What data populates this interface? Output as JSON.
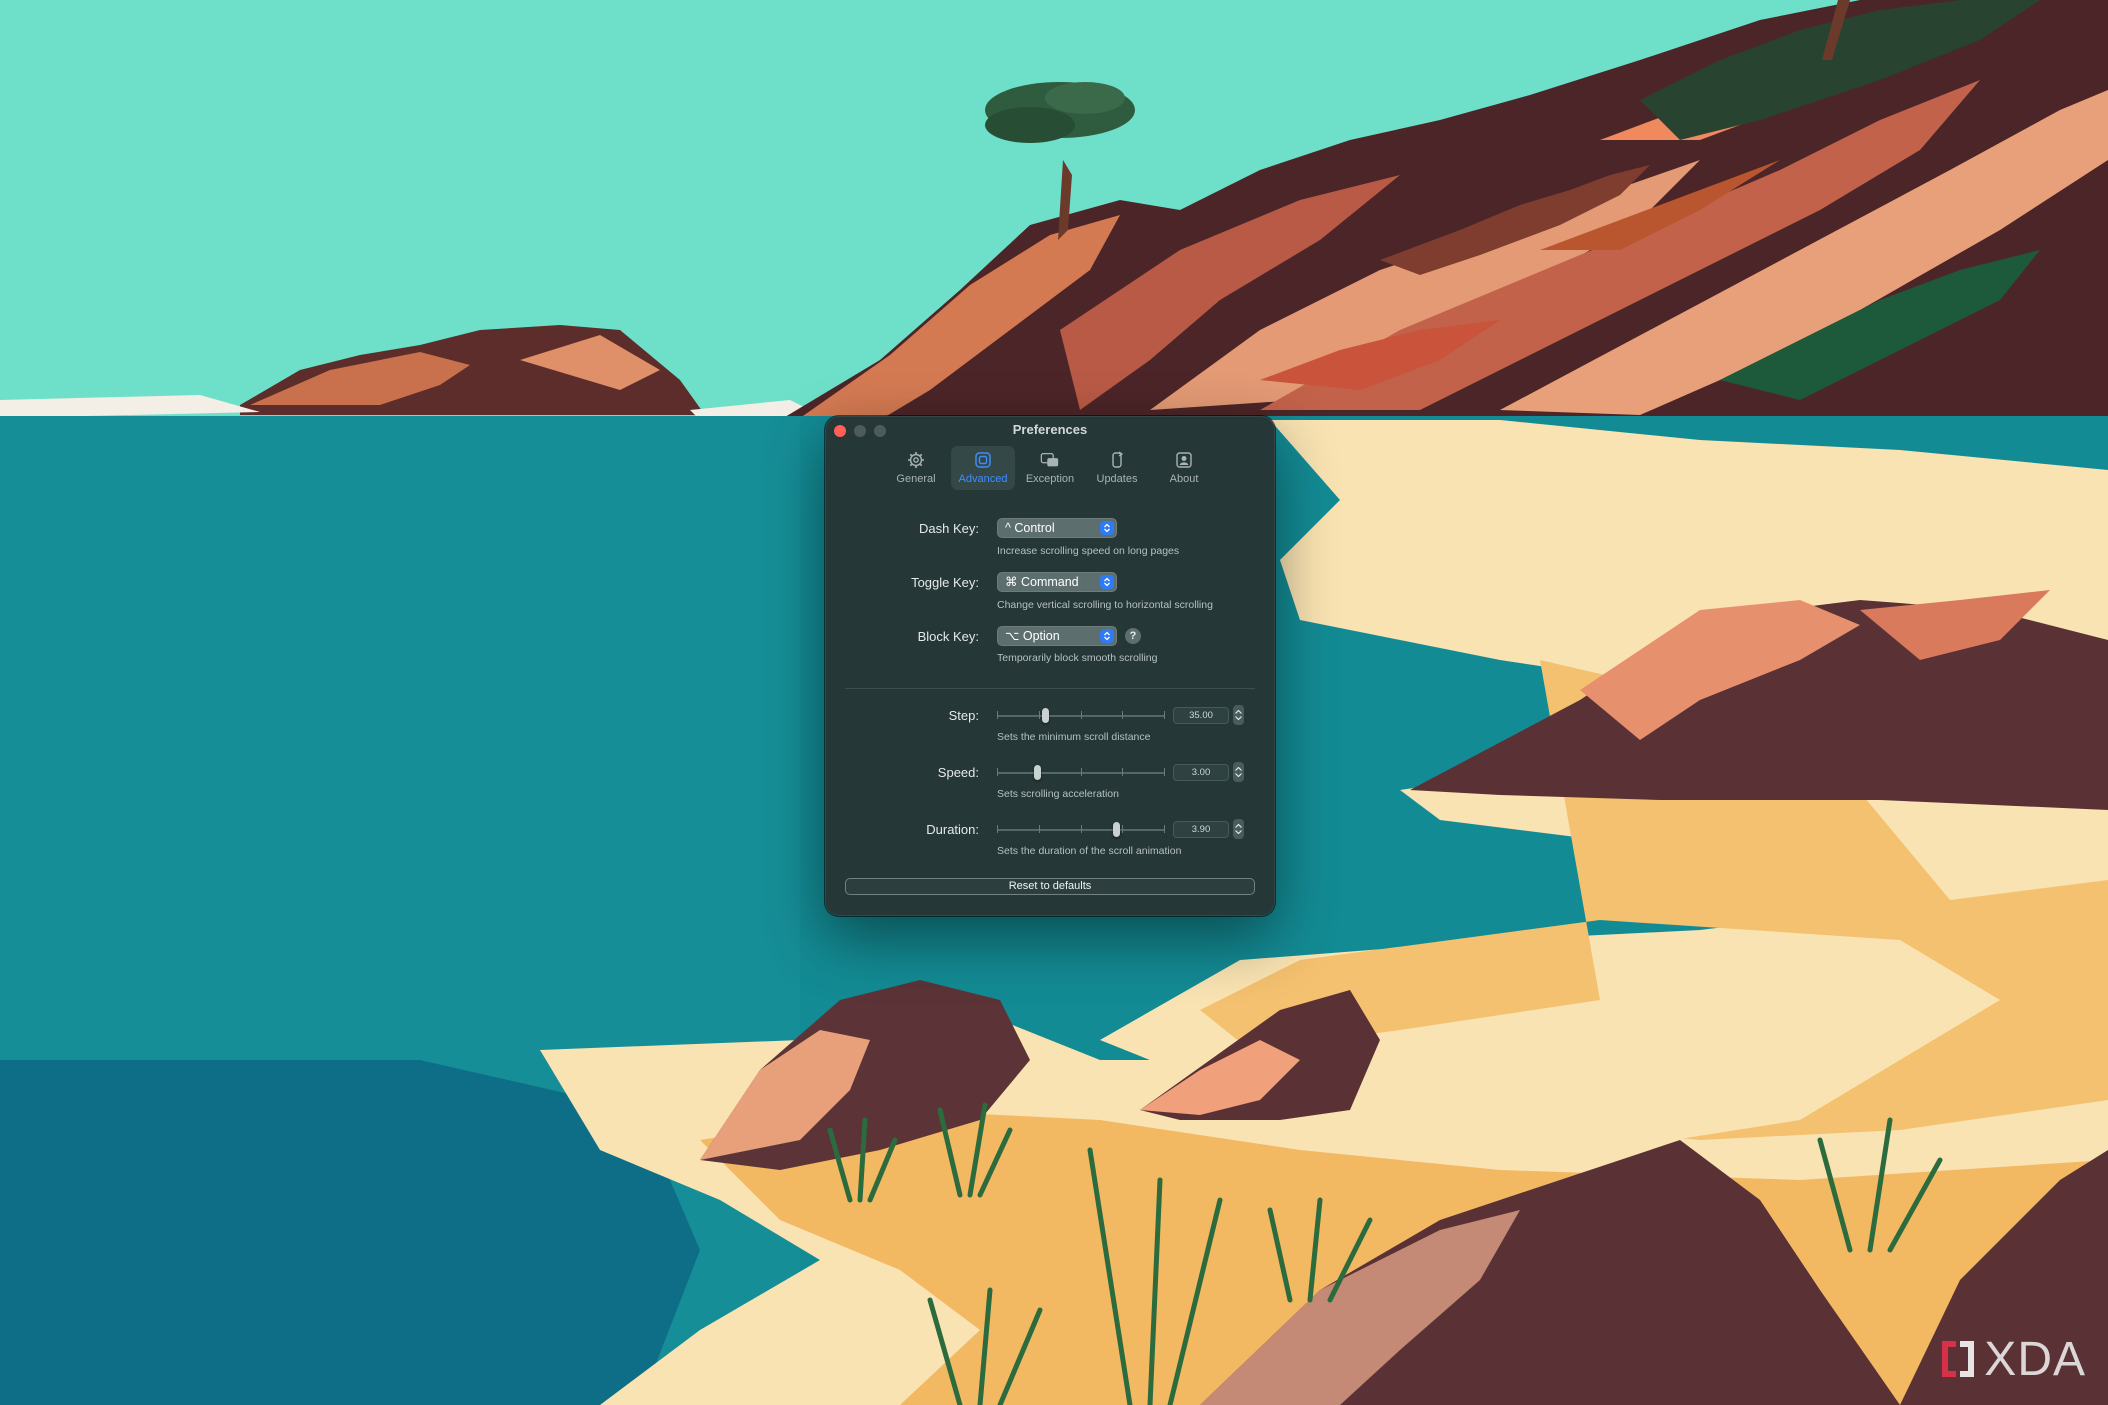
{
  "window": {
    "title": "Preferences",
    "tabs": [
      {
        "label": "General",
        "icon": "gear-icon",
        "active": false
      },
      {
        "label": "Advanced",
        "icon": "advanced-icon",
        "active": true
      },
      {
        "label": "Exception",
        "icon": "exception-icon",
        "active": false
      },
      {
        "label": "Updates",
        "icon": "updates-icon",
        "active": false
      },
      {
        "label": "About",
        "icon": "about-icon",
        "active": false
      }
    ],
    "keys": {
      "dash": {
        "label": "Dash Key:",
        "value": "^ Control",
        "description": "Increase scrolling speed on long pages"
      },
      "toggle": {
        "label": "Toggle Key:",
        "value": "⌘ Command",
        "description": "Change vertical scrolling to horizontal scrolling"
      },
      "block": {
        "label": "Block Key:",
        "value": "⌥ Option",
        "description": "Temporarily block smooth scrolling",
        "help": "?"
      }
    },
    "sliders": {
      "step": {
        "label": "Step:",
        "value": "35.00",
        "position": 0.28,
        "description": "Sets the minimum scroll distance"
      },
      "speed": {
        "label": "Speed:",
        "value": "3.00",
        "position": 0.23,
        "description": "Sets scrolling acceleration"
      },
      "duration": {
        "label": "Duration:",
        "value": "3.90",
        "position": 0.72,
        "description": "Sets the duration of the scroll animation"
      }
    },
    "reset_label": "Reset to defaults"
  },
  "colors": {
    "sky": "#6ee0c9",
    "sea": "#148d96",
    "sand": "#f0b765",
    "window_bg": "#253737",
    "accent": "#2f7bf6",
    "active_tab": "#3d8dff"
  },
  "watermark": {
    "text": "XDA"
  }
}
